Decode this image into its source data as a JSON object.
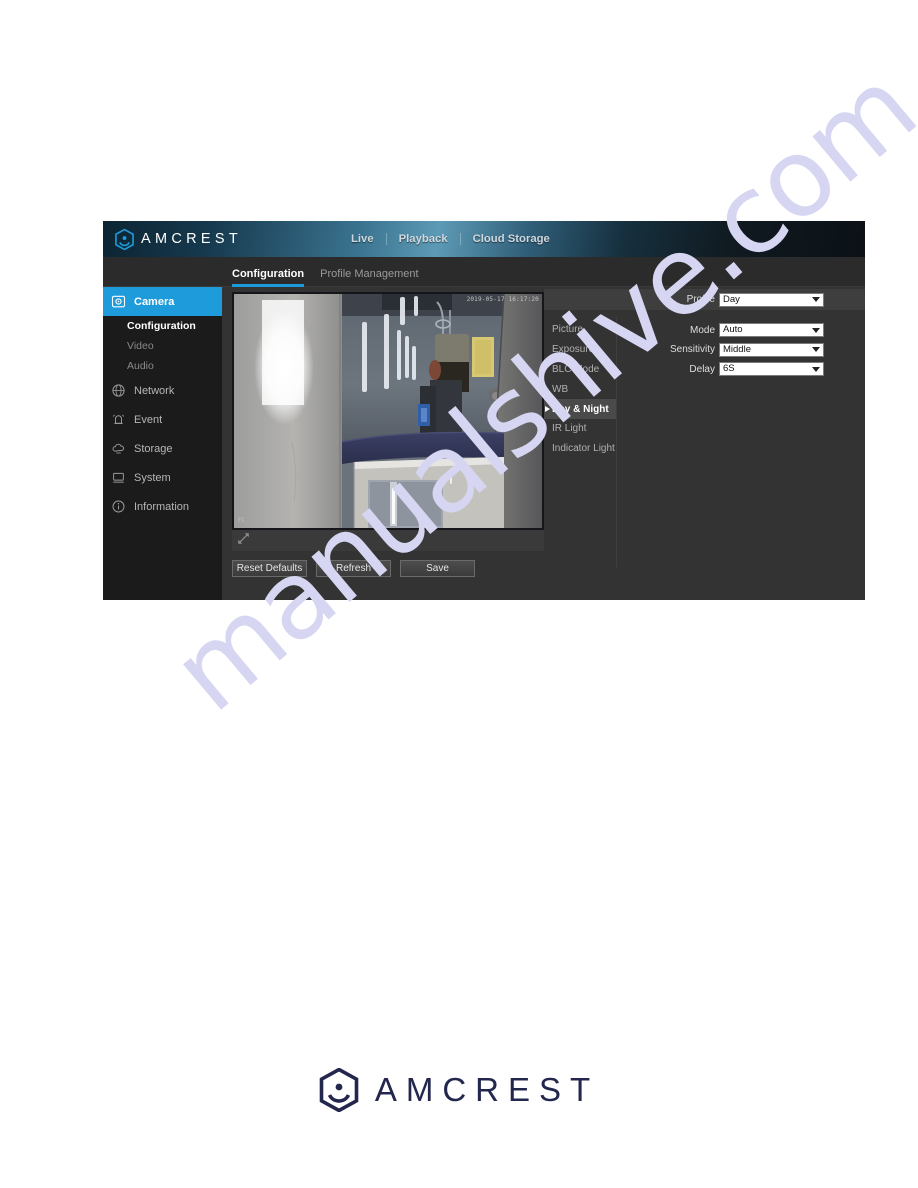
{
  "page": {
    "watermark_text": "manualshive.com",
    "watermark_color": "#d6d6f2"
  },
  "header": {
    "brand_name": "AMCREST",
    "brand_icon": "amcrest-hex-logo-icon",
    "nav": [
      {
        "label": "Live"
      },
      {
        "label": "Playback"
      },
      {
        "label": "Cloud Storage"
      }
    ]
  },
  "tabs": [
    {
      "label": "Configuration",
      "active": true
    },
    {
      "label": "Profile Management",
      "active": false
    }
  ],
  "sidebar": {
    "items": [
      {
        "label": "Camera",
        "icon": "camera-icon",
        "active": true
      },
      {
        "label": "Configuration",
        "icon": "",
        "sub": true,
        "active": true
      },
      {
        "label": "Video",
        "icon": "",
        "sub": true,
        "active": false
      },
      {
        "label": "Audio",
        "icon": "",
        "sub": true,
        "active": false
      },
      {
        "label": "Network",
        "icon": "network-globe-icon",
        "active": false
      },
      {
        "label": "Event",
        "icon": "alarm-bell-icon",
        "active": false
      },
      {
        "label": "Storage",
        "icon": "cloud-storage-icon",
        "active": false
      },
      {
        "label": "System",
        "icon": "monitor-icon",
        "active": false
      },
      {
        "label": "Information",
        "icon": "info-circle-icon",
        "active": false
      }
    ]
  },
  "video": {
    "timestamp_overlay": "2019-05-17 16:17:20",
    "corner_label": "FC",
    "fullscreen_icon": "fullscreen-expand-icon"
  },
  "subtabs": [
    {
      "label": "Picture",
      "active": false
    },
    {
      "label": "Exposure",
      "active": false
    },
    {
      "label": "BLC Mode",
      "active": false
    },
    {
      "label": "WB",
      "active": false
    },
    {
      "label": "Day & Night",
      "active": true
    },
    {
      "label": "IR Light",
      "active": false
    },
    {
      "label": "Indicator Light",
      "active": false
    }
  ],
  "form": {
    "profile": {
      "label": "Profile",
      "value": "Day"
    },
    "fields": [
      {
        "label": "Mode",
        "value": "Auto"
      },
      {
        "label": "Sensitivity",
        "value": "Middle"
      },
      {
        "label": "Delay",
        "value": "6S"
      }
    ]
  },
  "buttons": [
    {
      "label": "Reset Defaults"
    },
    {
      "label": "Refresh"
    },
    {
      "label": "Save"
    }
  ],
  "footer": {
    "brand_name": "AMCREST",
    "brand_icon": "amcrest-hex-logo-icon",
    "brand_color": "#23274d"
  },
  "colors": {
    "accent_blue": "#1d9bdb",
    "panel_bg": "#333333",
    "sidebar_bg": "#1b1b1b"
  }
}
